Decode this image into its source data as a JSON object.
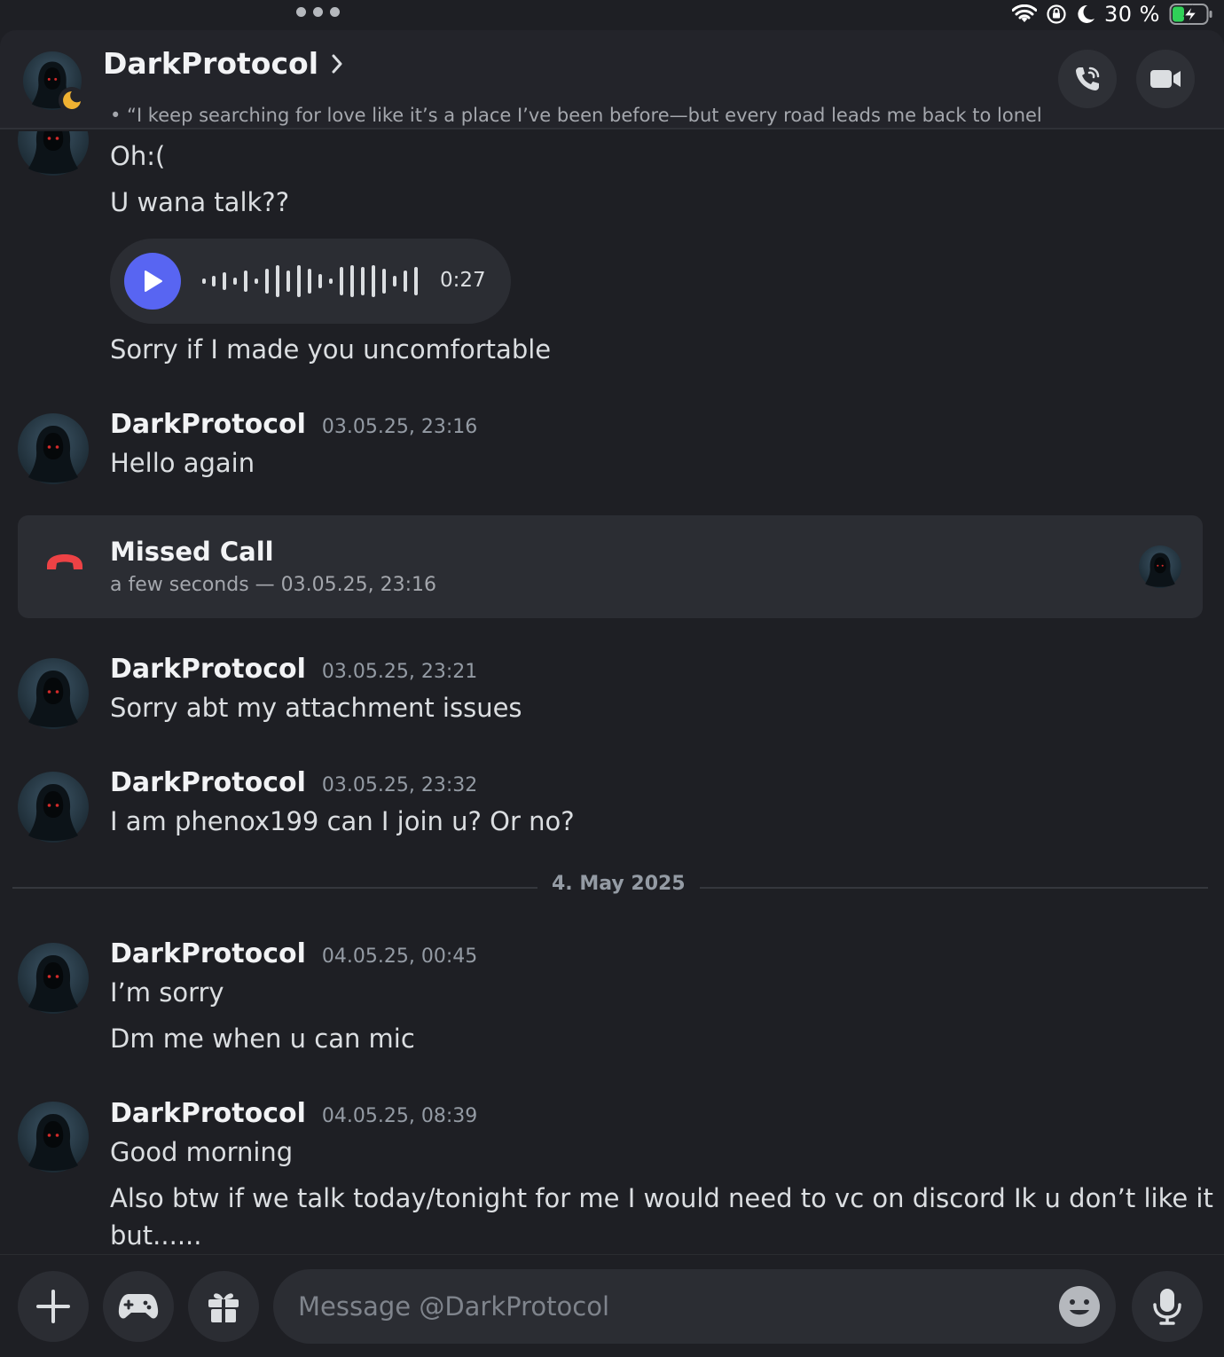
{
  "statusbar": {
    "battery_percent": "30 %",
    "icons": [
      "wifi-icon",
      "orientation-lock-icon",
      "moon-icon",
      "battery-charging-icon"
    ]
  },
  "header": {
    "name": "DarkProtocol",
    "status_text": "• “I keep searching for love like it’s a place I’ve been before—but every road leads me back to lonelin...",
    "presence": "idle",
    "call_icon": "phone-call-icon",
    "video_icon": "video-camera-icon"
  },
  "messages": {
    "group1": {
      "lines": [
        "Oh:(",
        "U wana talk??",
        "Sorry if I made you uncomfortable"
      ],
      "voice_duration": "0:27"
    },
    "group2": {
      "author": "DarkProtocol",
      "time": "03.05.25, 23:16",
      "lines": [
        "Hello again"
      ]
    },
    "missed_call": {
      "title": "Missed Call",
      "subtitle": "a few seconds — 03.05.25, 23:16"
    },
    "group3": {
      "author": "DarkProtocol",
      "time": "03.05.25, 23:21",
      "lines": [
        "Sorry abt my attachment issues"
      ]
    },
    "group4": {
      "author": "DarkProtocol",
      "time": "03.05.25, 23:32",
      "lines": [
        "I am phenox199 can I join u? Or no?"
      ]
    },
    "date_divider": "4. May 2025",
    "group5": {
      "author": "DarkProtocol",
      "time": "04.05.25, 00:45",
      "lines": [
        "I’m sorry",
        "Dm me when u can mic"
      ]
    },
    "group6": {
      "author": "DarkProtocol",
      "time": "04.05.25, 08:39",
      "lines": [
        "Good morning",
        "Also btw if we talk today/tonight for me I would need to vc on discord Ik u don’t like it",
        "but......"
      ]
    }
  },
  "composer": {
    "placeholder": "Message @DarkProtocol",
    "value": "",
    "buttons": [
      "plus-icon",
      "gamepad-icon",
      "gift-icon",
      "emoji-icon",
      "microphone-icon"
    ]
  },
  "colors": {
    "background": "#1e1f24",
    "accent": "#5865f2",
    "missed_call": "#ed4245",
    "idle": "#f0b232",
    "music": "#23a55a"
  }
}
